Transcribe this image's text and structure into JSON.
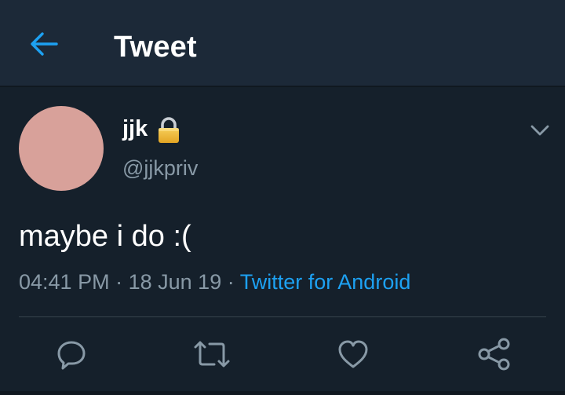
{
  "header": {
    "title": "Tweet",
    "back_icon": "arrow-left-icon",
    "back_icon_color": "#1da1f2"
  },
  "tweet": {
    "display_name": "jjk",
    "protected_icon": "lock-icon",
    "handle": "@jjkpriv",
    "avatar_color": "#d8a19a",
    "menu_icon": "chevron-down-icon",
    "text": "maybe i do :(",
    "time": "04:41 PM",
    "separator": "·",
    "date": "18 Jun 19",
    "source": "Twitter for Android"
  },
  "actions": [
    {
      "icon": "reply-icon"
    },
    {
      "icon": "retweet-icon"
    },
    {
      "icon": "like-icon"
    },
    {
      "icon": "share-icon"
    }
  ],
  "colors": {
    "background": "#15202b",
    "header_background": "#1c2938",
    "secondary_text": "#8899a6",
    "link": "#1da1f2",
    "divider": "#38444d"
  }
}
